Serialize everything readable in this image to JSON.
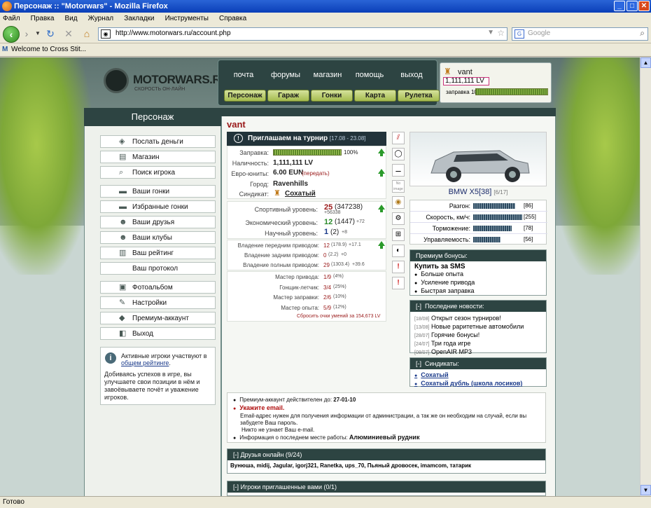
{
  "browser": {
    "title": "Персонаж :: \"Motorwars\" - Mozilla Firefox",
    "menu": [
      "Файл",
      "Правка",
      "Вид",
      "Журнал",
      "Закладки",
      "Инструменты",
      "Справка"
    ],
    "url": "http://www.motorwars.ru/account.php",
    "search_placeholder": "Google",
    "bookmark": "Welcome to Cross Stit...",
    "status": "Готово"
  },
  "site": {
    "logo": "MOTORWARS.RU",
    "logo_sub": "СКОРОСТЬ ОН-ЛАЙН",
    "top_menu": [
      "почта",
      "форумы",
      "магазин",
      "помощь",
      "выход"
    ],
    "sub_menu": [
      "Персонаж",
      "Гараж",
      "Гонки",
      "Карта",
      "Рулетка"
    ]
  },
  "user": {
    "name": "vant",
    "money": "1,111,111 LV",
    "fuel_label": "заправка 100%",
    "fuel_percent": 100
  },
  "sidebar": {
    "title": "Персонаж",
    "group1": [
      {
        "label": "Послать деньги",
        "icon": "money-icon"
      },
      {
        "label": "Магазин",
        "icon": "shop-icon"
      },
      {
        "label": "Поиск игрока",
        "icon": "search-icon"
      }
    ],
    "group2": [
      {
        "label": "Ваши гонки",
        "icon": "race-icon"
      },
      {
        "label": "Избранные гонки",
        "icon": "favorite-race-icon"
      },
      {
        "label": "Ваши друзья",
        "icon": "friends-icon"
      },
      {
        "label": "Ваши клубы",
        "icon": "clubs-icon"
      },
      {
        "label": "Ваш рейтинг",
        "icon": "rating-icon"
      },
      {
        "label": "Ваш протокол",
        "icon": ""
      }
    ],
    "group3": [
      {
        "label": "Фотоальбом",
        "icon": "photo-icon"
      },
      {
        "label": "Настройки",
        "icon": "settings-icon"
      },
      {
        "label": "Премиум-аккаунт",
        "icon": "premium-icon"
      },
      {
        "label": "Выход",
        "icon": "exit-icon"
      }
    ],
    "info_text1": "Активные игроки участвуют",
    "info_link_pre": "в",
    "info_link": "общем рейтинге",
    "info_text2": "Добиваясь успехов в игре, вы улучшаете свои позиции в нём и завоёвываете почёт и уважение игроков."
  },
  "profile": {
    "nick": "vant",
    "tournament": "Приглашаем на турнир",
    "tournament_dates": "[17.08 - 23.08]",
    "fuel_lbl": "Заправка:",
    "fuel_val": "100%",
    "cash_lbl": "Наличность:",
    "cash_val": "1,111,111 LV",
    "euro_lbl": "Евро-юниты:",
    "euro_val": "6.00 EUN",
    "euro_link": "(передать)",
    "city_lbl": "Город:",
    "city_val": "Ravenhills",
    "syndicate_lbl": "Синдикат:",
    "syndicate_val": "Сохатый",
    "levels": [
      {
        "lbl": "Спортивный уровень:",
        "val": "25",
        "sub": "(347238)",
        "extra": "+56338"
      },
      {
        "lbl": "Экономический уровень:",
        "val": "12",
        "sub": "(1447)",
        "extra": "+72"
      },
      {
        "lbl": "Научный уровень:",
        "val": "1",
        "sub": "(2)",
        "extra": "+8"
      }
    ],
    "drives": [
      {
        "lbl": "Владение передним приводом:",
        "val": "12",
        "sub": "(178.9)",
        "extra": "+17.1"
      },
      {
        "lbl": "Владение задним приводом:",
        "val": "0",
        "sub": "(2.2)",
        "extra": "+0"
      },
      {
        "lbl": "Владение полным приводом:",
        "val": "29",
        "sub": "(1303.4)",
        "extra": "+39.6"
      }
    ],
    "skills": [
      {
        "lbl": "Мастер привода:",
        "val": "1/9",
        "sub": "(4%)"
      },
      {
        "lbl": "Гонщик-летчик:",
        "val": "3/4",
        "sub": "(25%)"
      },
      {
        "lbl": "Мастер заправки:",
        "val": "2/6",
        "sub": "(10%)"
      },
      {
        "lbl": "Мастер опыта:",
        "val": "5/9",
        "sub": "(12%)"
      }
    ],
    "reset_link": "Сбросить очки умений за 154,673 LV",
    "no_image": "No image"
  },
  "car": {
    "name": "BMW X5[38]",
    "count": "[6/17]",
    "stats": [
      {
        "lbl": "Разгон:",
        "val": "[86]",
        "fill": 0.86
      },
      {
        "lbl": "Скорость, км/ч:",
        "val": "[255]",
        "fill": 1.0
      },
      {
        "lbl": "Торможение:",
        "val": "[78]",
        "fill": 0.78
      },
      {
        "lbl": "Управляемость:",
        "val": "[56]",
        "fill": 0.56
      }
    ]
  },
  "premium": {
    "title": "Премиум бонусы:",
    "head": "Купить за SMS",
    "items": [
      "Больше опыта",
      "Усиление привода",
      "Быстрая заправка"
    ]
  },
  "news": {
    "title": "Последние новости:",
    "toggle": "[-]",
    "items": [
      {
        "date": "[18/08]",
        "text": "Открыт сезон турниров!"
      },
      {
        "date": "[13/08]",
        "text": "Новые раритетные автомобили"
      },
      {
        "date": "[28/07]",
        "text": "Горячие бонусы!"
      },
      {
        "date": "[24/07]",
        "text": "Три года игре"
      },
      {
        "date": "[08/07]",
        "text": "OpenAIR MP3"
      }
    ]
  },
  "syndicates": {
    "title": "Синдикаты:",
    "toggle": "[-]",
    "items": [
      "Сохатый",
      "Сохатый дубль (школа лосиков)"
    ]
  },
  "notice": {
    "premium_pre": "Премиум-аккаунт действителен до:",
    "premium_date": "27-01-10",
    "email_title": "Укажите email.",
    "email_text": "Email-адрес нужен для получения информации от администрации, а так же он необходим на случай, если вы забудете Ваш пароль.",
    "email_note": "Никто не узнает Ваш e-mail.",
    "work_pre": "Информация о последнем месте работы:",
    "work_val": "Алюминиевый рудник"
  },
  "friends": {
    "title": "[-]  Друзья онлайн (9/24)",
    "list": "Вунюша, midij, Jagular, igorj321, Ranetka, ups_70, Пьяный дровосек, imamcom, татарик"
  },
  "invited": {
    "title": "[-]  Игроки приглашенные вами (0/1)"
  }
}
